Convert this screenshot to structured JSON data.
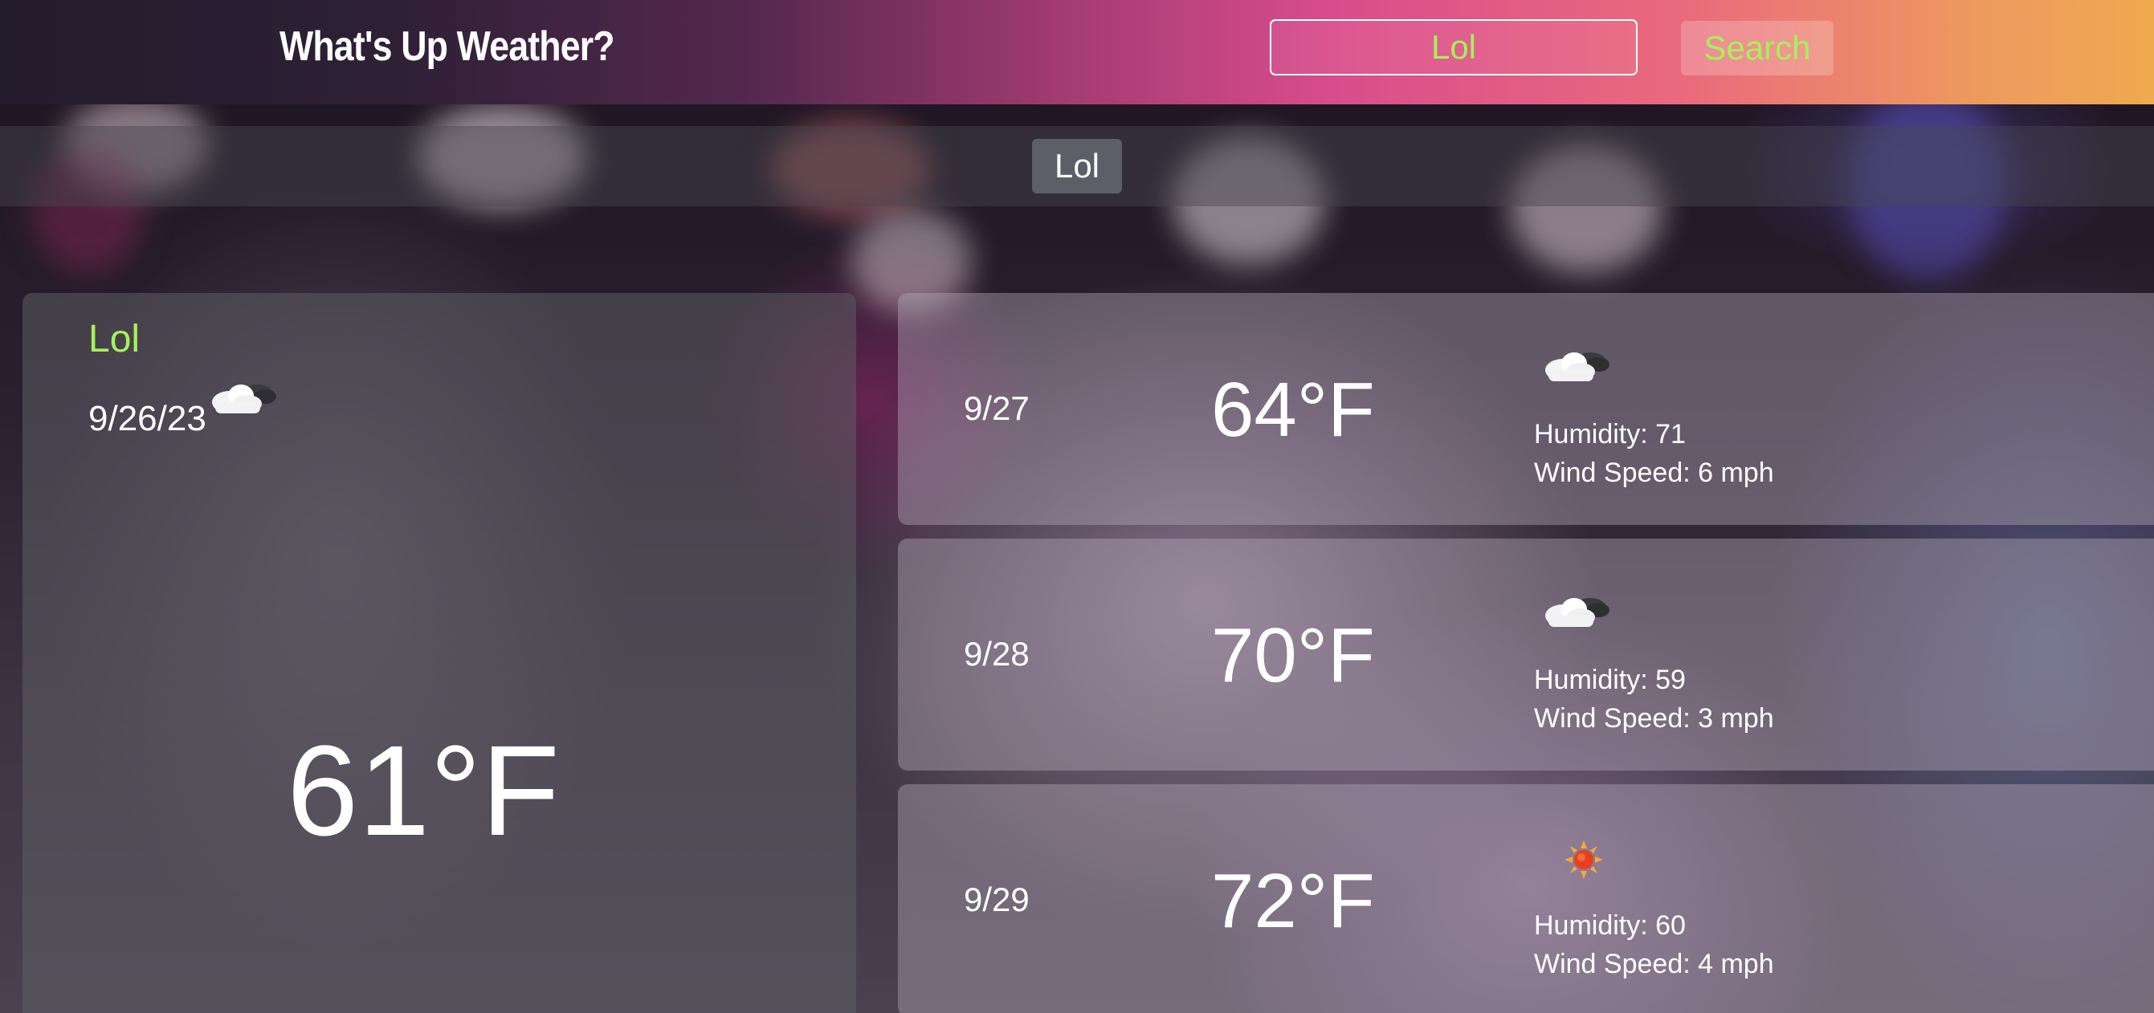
{
  "header": {
    "title": "What's Up Weather?",
    "search_value": "Lol",
    "search_button_label": "Search"
  },
  "history": {
    "items": [
      "Lol"
    ]
  },
  "current": {
    "city": "Lol",
    "date": "9/26/23",
    "icon": "cloudy-icon",
    "temperature": "61°F"
  },
  "forecast": [
    {
      "date": "9/27",
      "temperature": "64°F",
      "icon": "cloudy-icon",
      "humidity": "Humidity: 71",
      "wind": "Wind Speed: 6 mph"
    },
    {
      "date": "9/28",
      "temperature": "70°F",
      "icon": "cloudy-icon",
      "humidity": "Humidity: 59",
      "wind": "Wind Speed: 3 mph"
    },
    {
      "date": "9/29",
      "temperature": "72°F",
      "icon": "sun-icon",
      "humidity": "Humidity: 60",
      "wind": "Wind Speed: 4 mph"
    }
  ],
  "colors": {
    "accent": "#a5f25a",
    "header_start": "#231c2c",
    "header_mid": "#d94d8c",
    "header_end": "#efaa4e"
  }
}
